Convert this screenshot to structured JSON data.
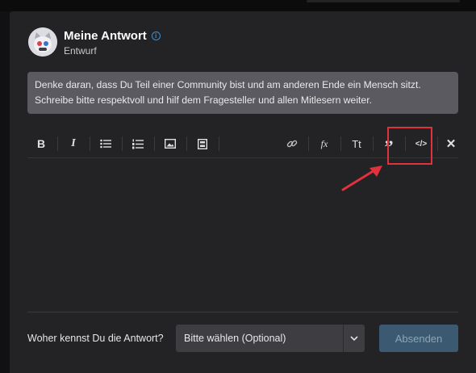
{
  "header": {
    "title": "Meine Antwort",
    "subtitle": "Entwurf",
    "info_icon": "i"
  },
  "notice": {
    "text": "Denke daran, dass Du Teil einer Community bist und am anderen Ende ein Mensch sitzt. Schreibe bitte respektvoll und hilf dem Fragesteller und allen Mitlesern weiter."
  },
  "toolbar": {
    "bold": "B",
    "italic": "I",
    "formula": "fx",
    "text_size": "Tt",
    "quote": "”",
    "code": "</>",
    "close": "✕",
    "icons": [
      "bold-icon",
      "italic-icon",
      "bullet-list-icon",
      "numbered-list-icon",
      "image-icon",
      "video-icon",
      "link-icon",
      "formula-icon",
      "text-size-icon",
      "quote-icon",
      "code-icon",
      "close-icon"
    ]
  },
  "footer": {
    "source_label": "Woher kennst Du die Antwort?",
    "select_value": "Bitte wählen (Optional)",
    "submit_label": "Absenden"
  },
  "colors": {
    "accent_red": "#e0313c",
    "submit_bg": "#3b5a72",
    "info_blue": "#3d8fd1"
  }
}
